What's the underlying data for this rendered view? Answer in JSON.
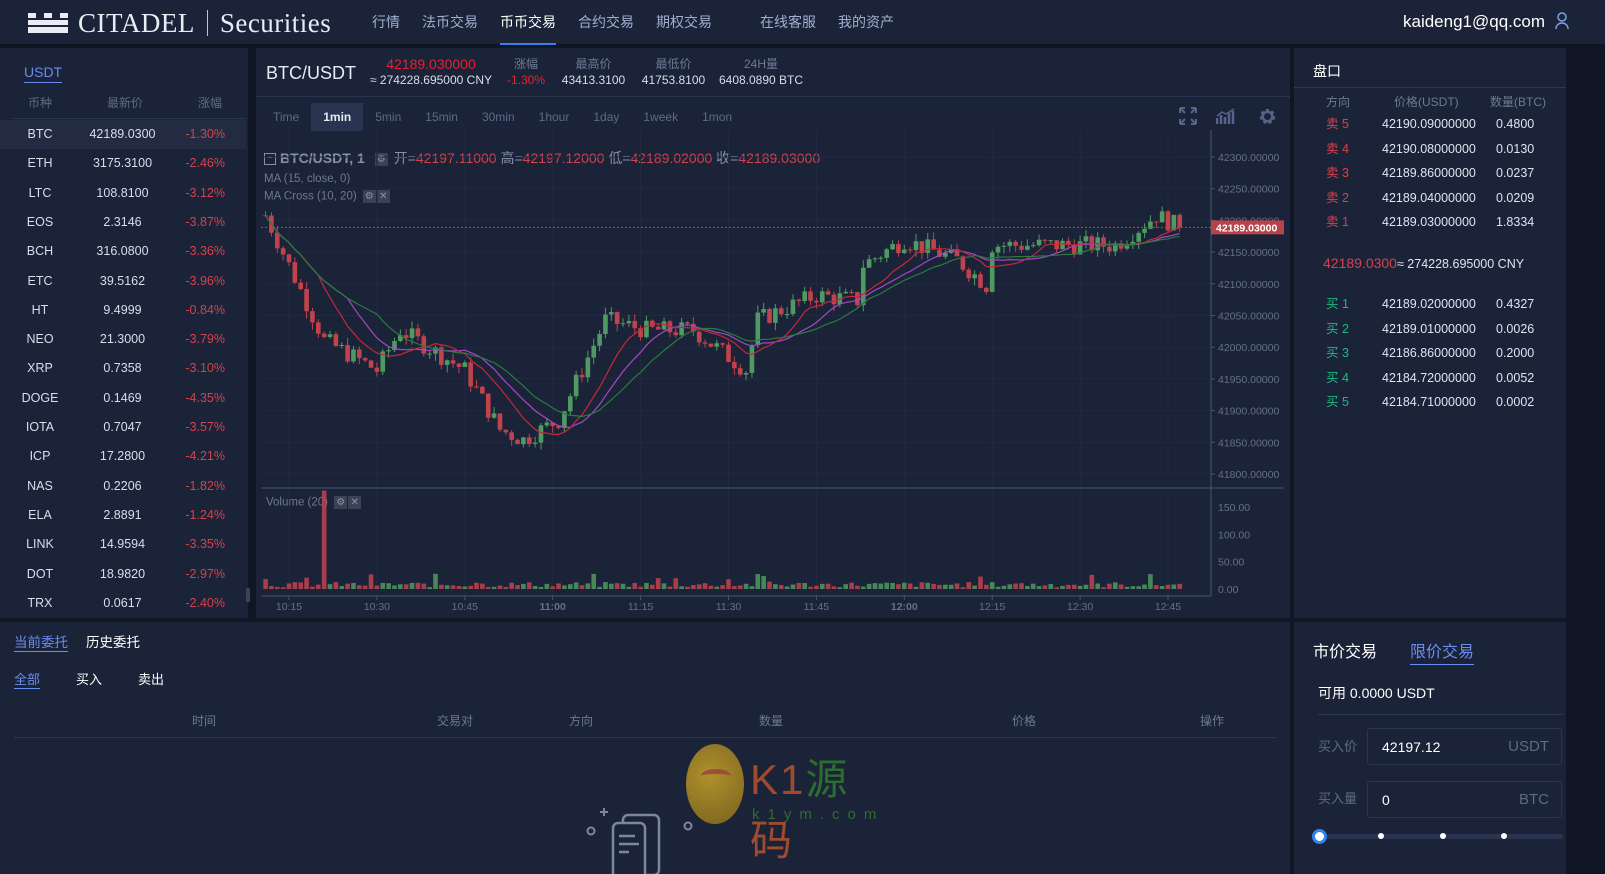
{
  "header": {
    "brand_left": "CITADEL",
    "brand_right": "Securities",
    "nav": [
      "行情",
      "法币交易",
      "币币交易",
      "合约交易",
      "期权交易",
      "在线客服",
      "我的资产"
    ],
    "active_nav": 2,
    "user_email": "kaideng1@qq.com"
  },
  "market_list": {
    "tab": "USDT",
    "headers": [
      "币种",
      "最新价",
      "涨幅"
    ],
    "rows": [
      {
        "coin": "BTC",
        "price": "42189.0300",
        "change": "-1.30%"
      },
      {
        "coin": "ETH",
        "price": "3175.3100",
        "change": "-2.46%"
      },
      {
        "coin": "LTC",
        "price": "108.8100",
        "change": "-3.12%"
      },
      {
        "coin": "EOS",
        "price": "2.3146",
        "change": "-3.87%"
      },
      {
        "coin": "BCH",
        "price": "316.0800",
        "change": "-3.36%"
      },
      {
        "coin": "ETC",
        "price": "39.5162",
        "change": "-3.96%"
      },
      {
        "coin": "HT",
        "price": "9.4999",
        "change": "-0.84%"
      },
      {
        "coin": "NEO",
        "price": "21.3000",
        "change": "-3.79%"
      },
      {
        "coin": "XRP",
        "price": "0.7358",
        "change": "-3.10%"
      },
      {
        "coin": "DOGE",
        "price": "0.1469",
        "change": "-4.35%"
      },
      {
        "coin": "IOTA",
        "price": "0.7047",
        "change": "-3.57%"
      },
      {
        "coin": "ICP",
        "price": "17.2800",
        "change": "-4.21%"
      },
      {
        "coin": "NAS",
        "price": "0.2206",
        "change": "-1.82%"
      },
      {
        "coin": "ELA",
        "price": "2.8891",
        "change": "-1.24%"
      },
      {
        "coin": "LINK",
        "price": "14.9594",
        "change": "-3.35%"
      },
      {
        "coin": "DOT",
        "price": "18.9820",
        "change": "-2.97%"
      },
      {
        "coin": "TRX",
        "price": "0.0617",
        "change": "-2.40%"
      }
    ]
  },
  "ticker": {
    "pair": "BTC/USDT",
    "last": "42189.030000",
    "cny": "≈ 274228.695000 CNY",
    "change_label": "涨幅",
    "change": "-1.30%",
    "high_label": "最高价",
    "high": "43413.3100",
    "low_label": "最低价",
    "low": "41753.8100",
    "vol_label": "24H量",
    "vol": "6408.0890 BTC"
  },
  "intervals": [
    "Time",
    "1min",
    "5min",
    "15min",
    "30min",
    "1hour",
    "1day",
    "1week",
    "1mon"
  ],
  "active_interval": 1,
  "chart_legend": {
    "symbol": "BTC/USDT, 1",
    "open_label": "开=",
    "open": "42197.11000",
    "high_label": "高=",
    "high": "42197.12000",
    "low_label": "低=",
    "low": "42189.02000",
    "close_label": "收=",
    "close": "42189.03000",
    "ma": "MA (15, close, 0)",
    "ma_cross": "MA Cross (10, 20)",
    "volume": "Volume (20)"
  },
  "chart_data": {
    "type": "candlestick",
    "title": "BTC/USDT, 1",
    "price_ticks": [
      "42300.00000",
      "42250.00000",
      "42200.00000",
      "42150.00000",
      "42100.00000",
      "42050.00000",
      "42000.00000",
      "41950.00000",
      "41900.00000",
      "41850.00000",
      "41800.00000"
    ],
    "price_tick_values": [
      42300,
      42250,
      42200,
      42150,
      42100,
      42050,
      42000,
      41950,
      41900,
      41850,
      41800
    ],
    "ylim": [
      41780,
      42320
    ],
    "last_price_label": "42189.03000",
    "last_price": 42189.03,
    "volume_ticks": [
      "150.00",
      "100.00",
      "50.00",
      "0.00"
    ],
    "volume_tick_values": [
      150,
      100,
      50,
      0
    ],
    "time_ticks": [
      "10:15",
      "10:30",
      "10:45",
      "11:00",
      "11:15",
      "11:30",
      "11:45",
      "12:00",
      "12:15",
      "12:30",
      "12:45"
    ],
    "time_tick_minutes": [
      615,
      630,
      645,
      660,
      675,
      690,
      705,
      720,
      735,
      750,
      765
    ],
    "start_minute": 611,
    "end_minute": 767,
    "price_path": [
      [
        611,
        42208
      ],
      [
        617,
        42090
      ],
      [
        621,
        42011
      ],
      [
        630,
        41964
      ],
      [
        634,
        42027
      ],
      [
        645,
        41964
      ],
      [
        651,
        41870
      ],
      [
        655,
        41854
      ],
      [
        661,
        41885
      ],
      [
        669,
        42043
      ],
      [
        676,
        42027
      ],
      [
        684,
        42027
      ],
      [
        693,
        41964
      ],
      [
        695,
        42043
      ],
      [
        705,
        42082
      ],
      [
        712,
        42074
      ],
      [
        713,
        42130
      ],
      [
        720,
        42169
      ],
      [
        729,
        42138
      ],
      [
        734,
        42098
      ],
      [
        735,
        42161
      ],
      [
        744,
        42161
      ],
      [
        756,
        42161
      ],
      [
        763,
        42208
      ],
      [
        767,
        42189
      ]
    ],
    "volume_spike": {
      "minute": 621,
      "value": 180
    },
    "series": [
      {
        "name": "MA 15",
        "color": "#a447c4"
      },
      {
        "name": "MA 10",
        "color": "#c4283a"
      },
      {
        "name": "MA 20",
        "color": "#2b7a3e"
      }
    ]
  },
  "order_book": {
    "title": "盘口",
    "headers": [
      "方向",
      "价格(USDT)",
      "数量(BTC)"
    ],
    "asks": [
      {
        "side": "卖 5",
        "price": "42190.09000000",
        "qty": "0.4800"
      },
      {
        "side": "卖 4",
        "price": "42190.08000000",
        "qty": "0.0130"
      },
      {
        "side": "卖 3",
        "price": "42189.86000000",
        "qty": "0.0237"
      },
      {
        "side": "卖 2",
        "price": "42189.04000000",
        "qty": "0.0209"
      },
      {
        "side": "卖 1",
        "price": "42189.03000000",
        "qty": "1.8334"
      }
    ],
    "mid_price": "42189.0300",
    "mid_cny": "≈ 274228.695000 CNY",
    "bids": [
      {
        "side": "买 1",
        "price": "42189.02000000",
        "qty": "0.4327"
      },
      {
        "side": "买 2",
        "price": "42189.01000000",
        "qty": "0.0026"
      },
      {
        "side": "买 3",
        "price": "42186.86000000",
        "qty": "0.2000"
      },
      {
        "side": "买 4",
        "price": "42184.72000000",
        "qty": "0.0052"
      },
      {
        "side": "买 5",
        "price": "42184.71000000",
        "qty": "0.0002"
      }
    ]
  },
  "orders": {
    "tabs": [
      "当前委托",
      "历史委托"
    ],
    "filters": [
      "全部",
      "买入",
      "卖出"
    ],
    "columns": [
      "时间",
      "交易对",
      "方向",
      "数量",
      "价格",
      "操作"
    ]
  },
  "trade": {
    "tabs": [
      "市价交易",
      "限价交易"
    ],
    "available": "可用 0.0000 USDT",
    "price_label": "买入价",
    "price_value": "42197.12",
    "price_unit": "USDT",
    "amount_label": "买入量",
    "amount_value": "0",
    "amount_unit": "BTC",
    "slider_percent": 0
  },
  "watermark": {
    "text": "K1源码",
    "url": "k1ym.com"
  },
  "colors": {
    "up": "#4f9a62",
    "down": "#c0434c",
    "accent": "#6b8cf0",
    "sell": "#d4424c",
    "buy": "#1fb880"
  }
}
